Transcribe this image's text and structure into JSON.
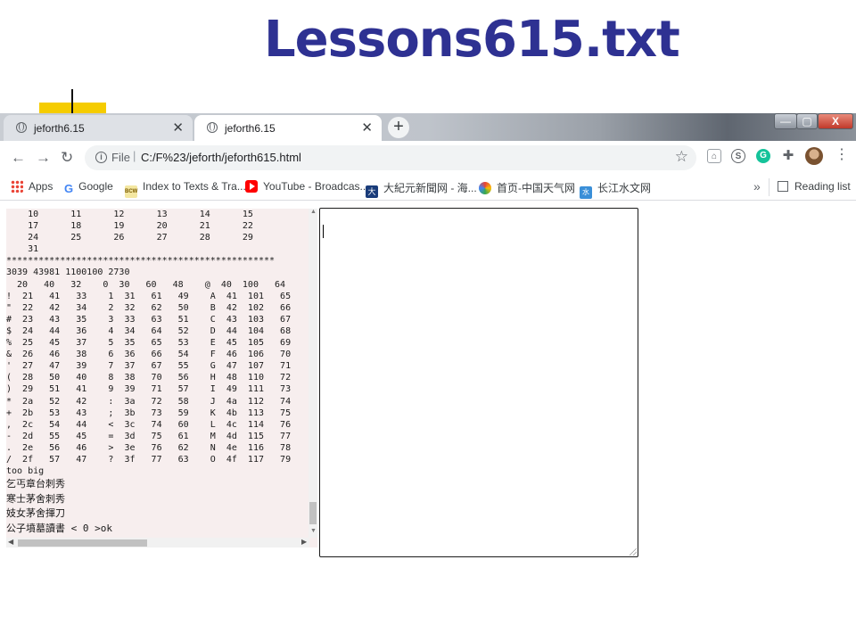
{
  "slide": {
    "title": "Lessons615.txt"
  },
  "browser": {
    "tabs": [
      {
        "title": "jeforth6.15",
        "active": false
      },
      {
        "title": "jeforth6.15",
        "active": true
      }
    ],
    "tab_close_glyph": "✕",
    "new_tab_glyph": "+",
    "window_controls": {
      "minimize": "—",
      "maximize": "▢",
      "close": "X"
    },
    "address": {
      "scheme_label": "File",
      "separator": "|",
      "url": "C:/F%23/jeforth/jeforth615.html"
    },
    "nav_icons": [
      "back-arrow-icon",
      "forward-arrow-icon",
      "reload-icon"
    ],
    "extensions": [
      "pocket-icon",
      "skype-icon",
      "grammarly-icon",
      "puzzle-icon"
    ],
    "bookmarks": [
      {
        "label": "Apps",
        "icon": "apps-grid-icon"
      },
      {
        "label": "Google",
        "icon": "google-icon"
      },
      {
        "label": "Index to Texts & Tra...",
        "icon": "bcw-icon"
      },
      {
        "label": "YouTube - Broadcas...",
        "icon": "youtube-icon"
      },
      {
        "label": "大紀元新聞网 - 海...",
        "icon": "dajiyuan-icon"
      },
      {
        "label": "首页-中国天气网",
        "icon": "weather-icon"
      },
      {
        "label": "长江水文网",
        "icon": "water-icon"
      }
    ],
    "bookmark_overflow": "»",
    "reading_list_label": "Reading list"
  },
  "terminal": {
    "lines": [
      "    10      11      12      13      14      15",
      "    17      18      19      20      21      22",
      "    24      25      26      27      28      29",
      "    31",
      "**************************************************",
      "3039 43981 1100100 2730",
      "  20   40   32    0  30   60   48    @  40  100   64",
      "!  21   41   33    1  31   61   49    A  41  101   65",
      "\"  22   42   34    2  32   62   50    B  42  102   66",
      "#  23   43   35    3  33   63   51    C  43  103   67",
      "$  24   44   36    4  34   64   52    D  44  104   68",
      "%  25   45   37    5  35   65   53    E  45  105   69",
      "&  26   46   38    6  36   66   54    F  46  106   70",
      "'  27   47   39    7  37   67   55    G  47  107   71",
      "(  28   50   40    8  38   70   56    H  48  110   72",
      ")  29   51   41    9  39   71   57    I  49  111   73",
      "*  2a   52   42    :  3a   72   58    J  4a  112   74",
      "+  2b   53   43    ;  3b   73   59    K  4b  113   75",
      ",  2c   54   44    <  3c   74   60    L  4c  114   76",
      "-  2d   55   45    =  3d   75   61    M  4d  115   77",
      ".  2e   56   46    >  3e   76   62    N  4e  116   78",
      "/  2f   57   47    ?  3f   77   63    O  4f  117   79",
      "too big"
    ],
    "cjk_lines": [
      "乞丐章台刺秀",
      "寒士茅舍刺秀",
      "妓女茅舍揮刀"
    ],
    "prompt_line": "公子墳墓讀書 < 0 >ok"
  },
  "scroll_glyphs": {
    "up": "▲",
    "down": "▼",
    "left": "◀",
    "right": "▶"
  }
}
